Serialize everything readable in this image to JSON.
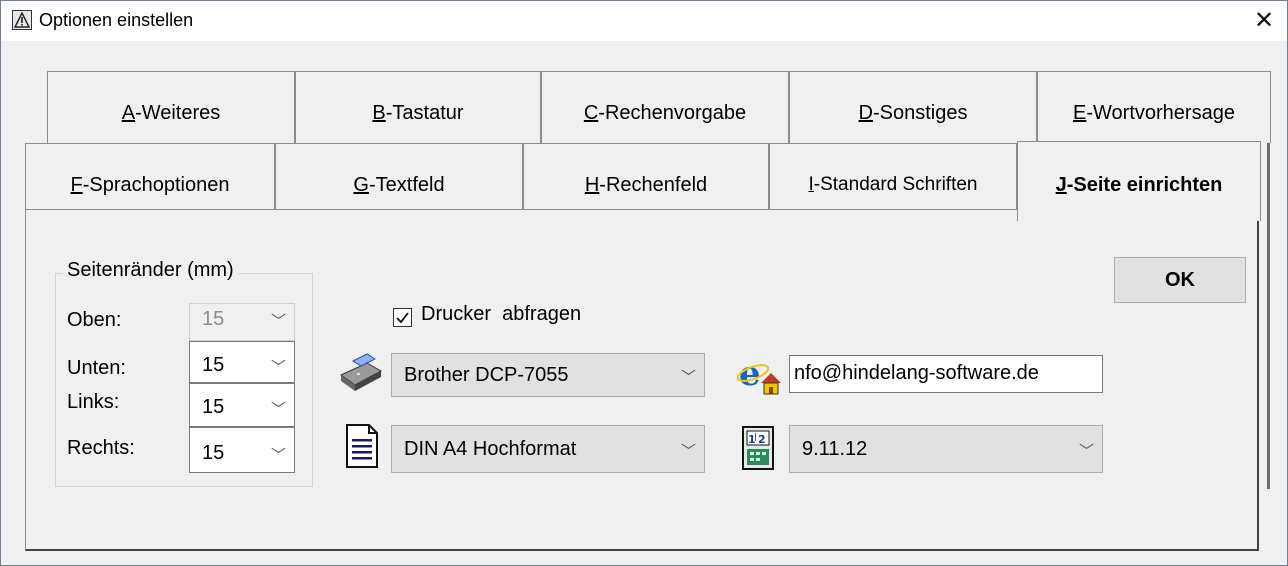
{
  "window": {
    "title": "Optionen einstellen",
    "close_glyph": "✕"
  },
  "tabs_row1": [
    {
      "key": "A",
      "rest": "-Weiteres"
    },
    {
      "key": "B",
      "rest": "-Tastatur"
    },
    {
      "key": "C",
      "rest": "-Rechenvorgabe"
    },
    {
      "key": "D",
      "rest": "-Sonstiges"
    },
    {
      "key": "E",
      "rest": "-Wortvorhersage"
    }
  ],
  "tabs_row2": [
    {
      "key": "F",
      "rest": "-Sprachoptionen"
    },
    {
      "key": "G",
      "rest": "-Textfeld"
    },
    {
      "key": "H",
      "rest": "-Rechenfeld"
    },
    {
      "key": "I",
      "rest": "-Standard Schriften"
    },
    {
      "key": "J",
      "rest": "-Seite einrichten",
      "active": true
    }
  ],
  "margins": {
    "group_label": "Seitenränder (mm)",
    "top_label": "Oben:",
    "top_value": "15",
    "bottom_label": "Unten:",
    "bottom_value": "15",
    "left_label": "Links:",
    "left_value": "15",
    "right_label": "Rechts:",
    "right_value": "15"
  },
  "printer": {
    "query_label": "Drucker  abfragen",
    "query_checked": true,
    "selected": "Brother DCP-7055",
    "icon": "printer-icon"
  },
  "paper": {
    "selected": "DIN A4 Hochformat",
    "icon": "document-icon"
  },
  "email": {
    "value": "nfo@hindelang-software.de",
    "icon": "internet-explorer-home-icon"
  },
  "date_format": {
    "selected": "9.11.12",
    "icon": "calendar-icon"
  },
  "ok_label": "OK",
  "colors": {
    "window_bg": "#f0f0f0",
    "border": "#8c8c8c",
    "titlebar_border": "#6b7f99"
  }
}
